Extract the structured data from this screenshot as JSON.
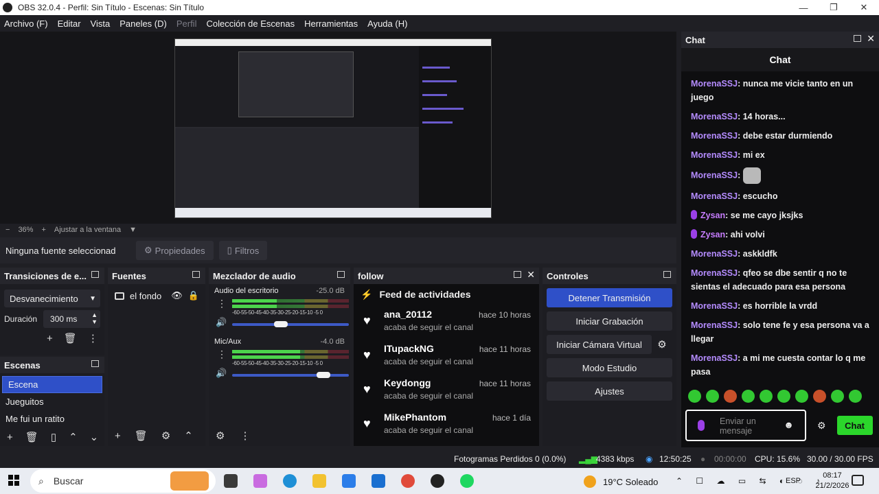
{
  "window": {
    "title": "OBS 32.0.4 - Perfil: Sin Título - Escenas: Sin Título",
    "minimize": "—",
    "maximize": "❐",
    "close": "✕"
  },
  "menu": [
    "Archivo (F)",
    "Editar",
    "Vista",
    "Paneles (D)",
    "Perfil",
    "Colección de Escenas",
    "Herramientas",
    "Ayuda (H)"
  ],
  "zoom": {
    "minus": "−",
    "level": "36%",
    "plus": "+",
    "fit": "Ajustar a la ventana",
    "arrow": "▼"
  },
  "source_toolbar": {
    "no_source": "Ninguna fuente seleccionad",
    "properties": "Propiedades",
    "filters": "Filtros"
  },
  "transitions": {
    "title": "Transiciones de e...",
    "selected": "Desvanecimiento",
    "duration_label": "Duración",
    "duration_value": "300 ms"
  },
  "scenes": {
    "title": "Escenas",
    "items": [
      "Escena",
      "Jueguitos",
      "Me fui un ratito"
    ]
  },
  "sources": {
    "title": "Fuentes",
    "items": [
      {
        "name": "el fondo"
      }
    ]
  },
  "mixer": {
    "title": "Mezclador de audio",
    "ticks": "-60-55-50-45-40-35-30-25-20-15-10 -5  0",
    "channels": [
      {
        "name": "Audio del escritorio",
        "db": "-25.0 dB",
        "level": 0.38,
        "volume": 0.42
      },
      {
        "name": "Mic/Aux",
        "db": "-4.0 dB",
        "level": 0.58,
        "volume": 0.78
      }
    ]
  },
  "follow": {
    "title": "follow",
    "feed_title": "Feed de actividades",
    "items": [
      {
        "user": "ana_20112",
        "ago": "hace 10 horas",
        "action": "acaba de seguir el canal"
      },
      {
        "user": "ITupackNG",
        "ago": "hace 11 horas",
        "action": "acaba de seguir el canal"
      },
      {
        "user": "Keydongg",
        "ago": "hace 11 horas",
        "action": "acaba de seguir el canal"
      },
      {
        "user": "MikePhantom",
        "ago": "hace 1 día",
        "action": "acaba de seguir el canal"
      }
    ]
  },
  "controls": {
    "title": "Controles",
    "stop_stream": "Detener Transmisión",
    "start_recording": "Iniciar Grabación",
    "start_virtual_cam": "Iniciar Cámara Virtual",
    "studio_mode": "Modo Estudio",
    "settings": "Ajustes"
  },
  "chat": {
    "dock_title": "Chat",
    "header": "Chat",
    "messages": [
      {
        "user": "MorenaSSJ",
        "text": "nunca me vicie tanto en un juego",
        "badge": false
      },
      {
        "user": "MorenaSSJ",
        "text": "14 horas...",
        "badge": false
      },
      {
        "user": "MorenaSSJ",
        "text": "debe estar durmiendo",
        "badge": false
      },
      {
        "user": "MorenaSSJ",
        "text": "mi ex",
        "badge": false
      },
      {
        "user": "MorenaSSJ",
        "text": "",
        "badge": false,
        "emote": true
      },
      {
        "user": "MorenaSSJ",
        "text": "escucho",
        "badge": false
      },
      {
        "user": "Zysan",
        "text": "se me cayo jksjks",
        "badge": true
      },
      {
        "user": "Zysan",
        "text": "ahi volvi",
        "badge": true
      },
      {
        "user": "MorenaSSJ",
        "text": "askkldfk",
        "badge": false
      },
      {
        "user": "MorenaSSJ",
        "text": "qfeo se dbe sentir q no te sientas el adecuado para esa persona",
        "badge": false
      },
      {
        "user": "MorenaSSJ",
        "text": "es horrible la vrdd",
        "badge": false
      },
      {
        "user": "MorenaSSJ",
        "text": "solo tene fe y esa persona va a llegar",
        "badge": false
      },
      {
        "user": "MorenaSSJ",
        "text": "a mi me cuesta contar lo q me pasa",
        "badge": false
      }
    ],
    "input_placeholder": "Enviar un mensaje",
    "send": "Chat"
  },
  "status": {
    "dropped": "Fotogramas Perdidos 0 (0.0%)",
    "bitrate": "4383 kbps",
    "live_time": "12:50:25",
    "rec_time": "00:00:00",
    "cpu": "CPU: 15.6%",
    "fps": "30.00 / 30.00 FPS"
  },
  "taskbar": {
    "search": "Buscar",
    "weather": "19°C Soleado",
    "lang": "ESP",
    "time": "08:17",
    "date": "21/2/2026"
  },
  "colors": {
    "accent": "#2f50c8",
    "chat_user": "#b58cff",
    "send": "#2bd62b"
  }
}
